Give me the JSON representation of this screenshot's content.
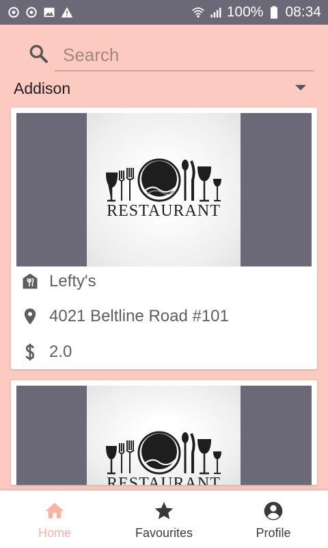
{
  "status_bar": {
    "battery_text": "100%",
    "time": "08:34",
    "icons": [
      "sync-icon",
      "sync-icon",
      "image-icon",
      "warning-icon",
      "wifi-icon",
      "signal-icon",
      "battery-icon"
    ]
  },
  "search": {
    "placeholder": "Search",
    "value": ""
  },
  "city_selector": {
    "selected": "Addison"
  },
  "restaurants": [
    {
      "logo_text": "RESTAURANT",
      "name": "Lefty's",
      "address": "4021 Beltline Road #101",
      "price": "2.0"
    },
    {
      "logo_text": "RESTAURANT"
    }
  ],
  "bottom_nav": {
    "items": [
      {
        "label": "Home",
        "icon": "home-icon",
        "active": true
      },
      {
        "label": "Favourites",
        "icon": "star-icon",
        "active": false
      },
      {
        "label": "Profile",
        "icon": "account-icon",
        "active": false
      }
    ]
  },
  "colors": {
    "background": "#fccac0",
    "status_bar": "#6b6878",
    "image_side": "#6b6878",
    "nav_active": "#f8b3a6",
    "nav_inactive": "#3a3a3a"
  }
}
